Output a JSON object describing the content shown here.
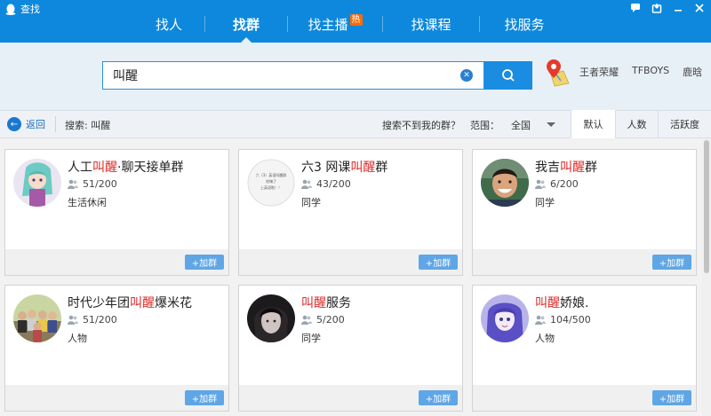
{
  "window": {
    "title": "查找",
    "controls": [
      "comment-icon",
      "restore-icon",
      "minimize-icon",
      "close-icon"
    ]
  },
  "tabs": [
    {
      "label": "找人",
      "active": false
    },
    {
      "label": "找群",
      "active": true
    },
    {
      "label": "找主播",
      "badge": "热",
      "active": false
    },
    {
      "label": "找课程",
      "active": false
    },
    {
      "label": "找服务",
      "active": false
    }
  ],
  "search": {
    "value": "叫醒",
    "hot_words": [
      "王者荣耀",
      "TFBOYS",
      "鹿晗"
    ]
  },
  "filter": {
    "back_label": "返回",
    "search_prefix": "搜索:",
    "search_term": "叫醒",
    "not_found": "搜索不到我的群？",
    "range_label": "范围：",
    "range_value": "全国",
    "sort_tabs": [
      {
        "label": "默认",
        "active": true
      },
      {
        "label": "人数",
        "active": false
      },
      {
        "label": "活跃度",
        "active": false
      }
    ]
  },
  "join_label": "+加群",
  "groups": [
    {
      "pre": "人工",
      "hl": "叫醒",
      "post": "·聊天接单群",
      "members": "51/200",
      "tag": "生活休闲",
      "avatar": "anime-girl"
    },
    {
      "pre": "六3 网课",
      "hl": "叫醒",
      "post": "群",
      "members": "43/200",
      "tag": "同学",
      "avatar": "text-logo",
      "avatar_text": [
        "六（3）英语叫醒群",
        "哎嗨了",
        "上英语啦！！"
      ]
    },
    {
      "pre": "我吉",
      "hl": "叫醒",
      "post": "群",
      "members": "6/200",
      "tag": "同学",
      "avatar": "smiling-boy"
    },
    {
      "pre": "时代少年团",
      "hl": "叫醒",
      "post": "爆米花",
      "members": "51/200",
      "tag": "人物",
      "avatar": "group-photo"
    },
    {
      "pre": "",
      "hl": "叫醒",
      "post": "服务",
      "members": "5/200",
      "tag": "同学",
      "avatar": "dark-portrait"
    },
    {
      "pre": "",
      "hl": "叫醒",
      "post": "娇娘.",
      "members": "104/500",
      "tag": "人物",
      "avatar": "anime-purple"
    }
  ],
  "colors": {
    "brand_blue": "#0e88dc",
    "highlight_red": "#e02a2a",
    "join_button": "#5fa6e6",
    "hot_badge": "#ff6a00"
  }
}
